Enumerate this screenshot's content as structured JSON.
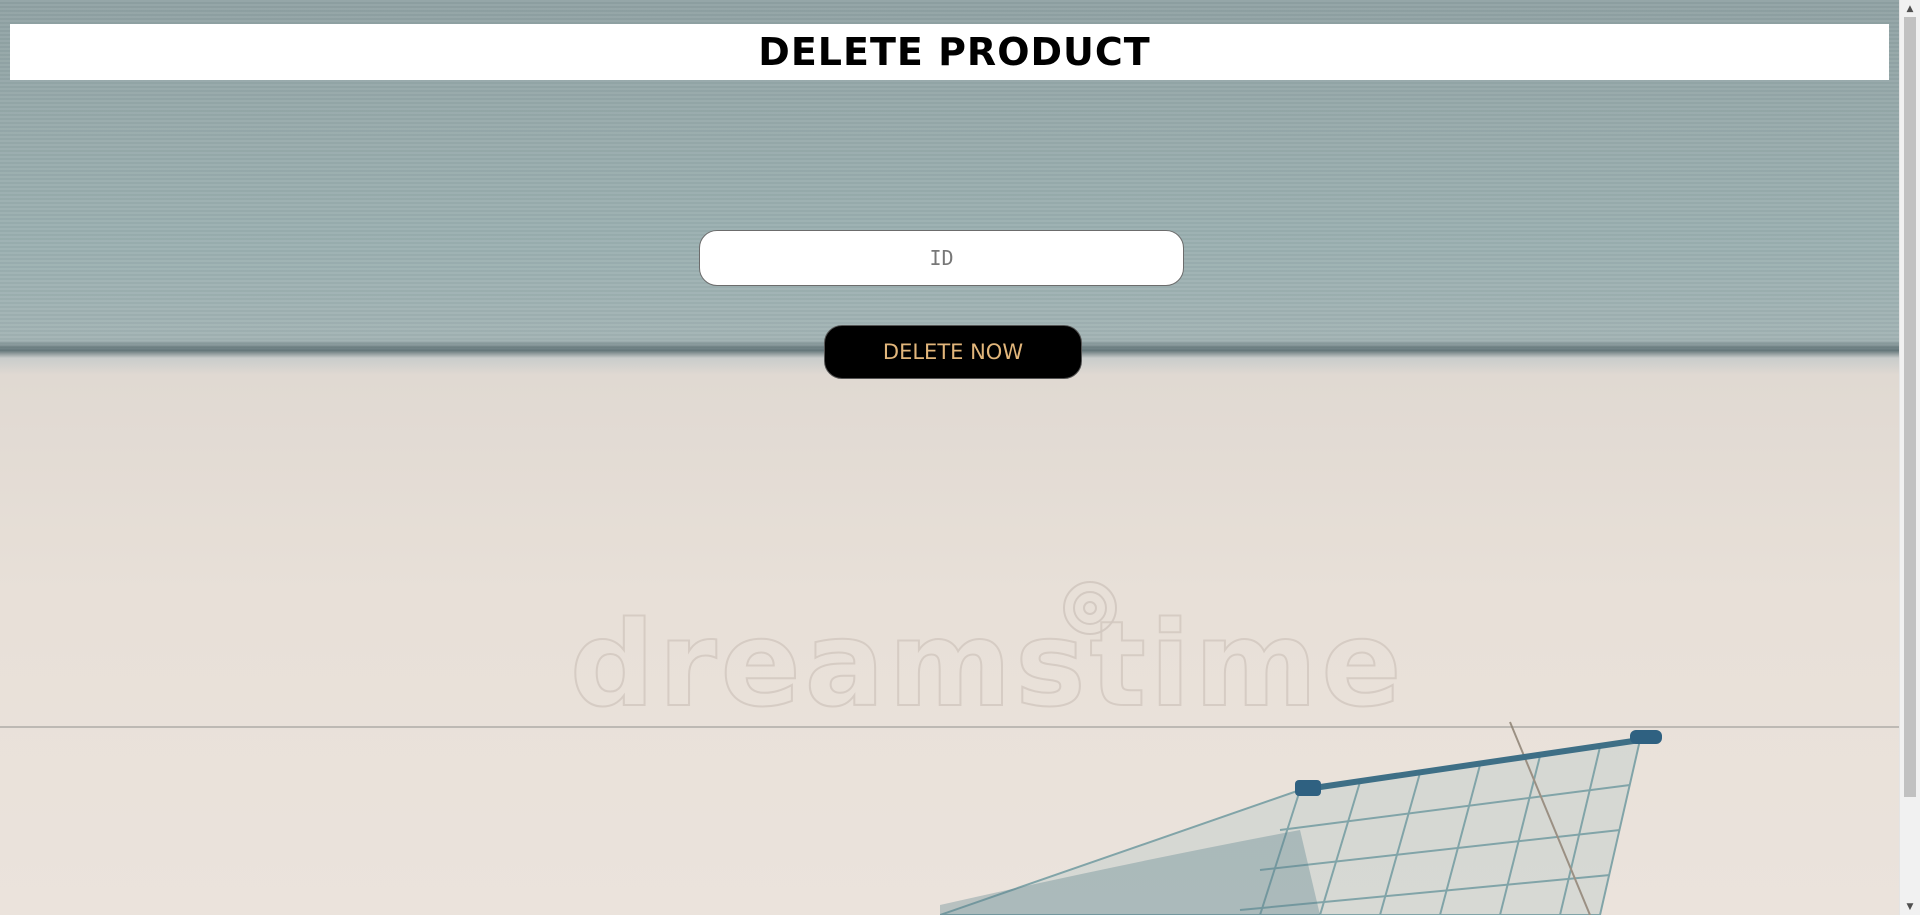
{
  "header": {
    "title": "DELETE PRODUCT"
  },
  "form": {
    "id_input": {
      "placeholder": "ID",
      "value": ""
    },
    "delete_button_label": "DELETE NOW"
  },
  "background": {
    "watermark_text": "dreamstime",
    "watermark_mark": "®",
    "image_subject": "shopping-cart-icon"
  },
  "colors": {
    "header_bg": "#ffffff",
    "button_bg": "#000000",
    "button_text": "#e2b67b",
    "wall": "#9aafb0",
    "floor": "#e8e0d8"
  }
}
